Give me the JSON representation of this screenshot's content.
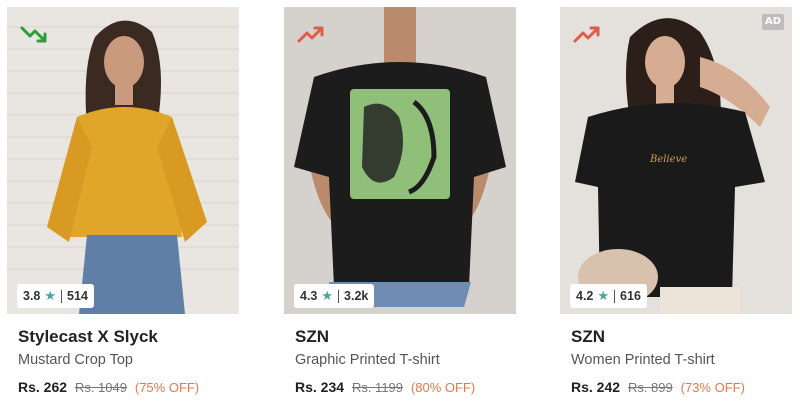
{
  "products": [
    {
      "trend_icon": "trend-down-icon",
      "trend_color": "#2e9c3a",
      "ad": null,
      "rating": "3.8",
      "reviews": "514",
      "brand": "Stylecast X Slyck",
      "title": "Mustard Crop Top",
      "price": "Rs. 262",
      "mrp": "Rs. 1049",
      "off": "(75% OFF)",
      "image_desc": "model-in-mustard-crop-top"
    },
    {
      "trend_icon": "trend-up-icon",
      "trend_color": "#e15b4b",
      "ad": null,
      "rating": "4.3",
      "reviews": "3.2k",
      "brand": "SZN",
      "title": "Graphic Printed T-shirt",
      "price": "Rs. 234",
      "mrp": "Rs. 1199",
      "off": "(80% OFF)",
      "image_desc": "model-in-black-graphic-tshirt"
    },
    {
      "trend_icon": "trend-up-icon",
      "trend_color": "#e15b4b",
      "ad": "AD",
      "rating": "4.2",
      "reviews": "616",
      "brand": "SZN",
      "title": "Women Printed T-shirt",
      "price": "Rs. 242",
      "mrp": "Rs. 899",
      "off": "(73% OFF)",
      "image_desc": "model-in-black-printed-tshirt"
    }
  ],
  "colors": {
    "star": "#4aa49a",
    "discount": "#e77846",
    "text_primary": "#222222",
    "text_secondary": "#555555"
  }
}
